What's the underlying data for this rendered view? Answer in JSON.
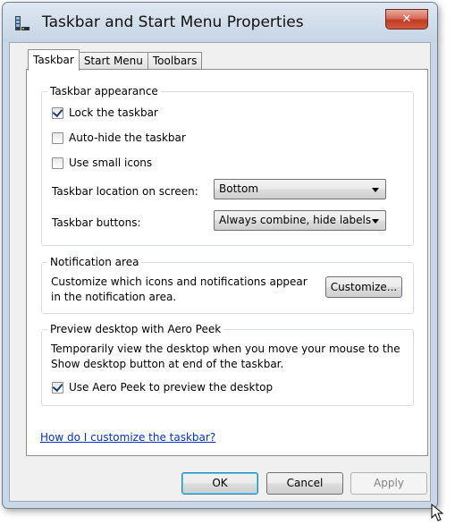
{
  "window": {
    "title": "Taskbar and Start Menu Properties",
    "close_label": "✕"
  },
  "tabs": [
    {
      "label": "Taskbar",
      "active": true
    },
    {
      "label": "Start Menu",
      "active": false
    },
    {
      "label": "Toolbars",
      "active": false
    }
  ],
  "taskbar_appearance": {
    "group_label": "Taskbar appearance",
    "lock_taskbar": {
      "label": "Lock the taskbar",
      "checked": true
    },
    "auto_hide": {
      "label": "Auto-hide the taskbar",
      "checked": false
    },
    "small_icons": {
      "label": "Use small icons",
      "checked": false
    },
    "location_label": "Taskbar location on screen:",
    "location_value": "Bottom",
    "buttons_label": "Taskbar buttons:",
    "buttons_value": "Always combine, hide labels"
  },
  "notification_area": {
    "group_label": "Notification area",
    "description": "Customize which icons and notifications appear in the notification area.",
    "customize_label": "Customize..."
  },
  "aero_peek": {
    "group_label": "Preview desktop with Aero Peek",
    "description": "Temporarily view the desktop when you move your mouse to the Show desktop button at end of the taskbar.",
    "use_aero_peek": {
      "label": "Use Aero Peek to preview the desktop",
      "checked": true
    }
  },
  "help_link": "How do I customize the taskbar?",
  "footer": {
    "ok_label": "OK",
    "cancel_label": "Cancel",
    "apply_label": "Apply"
  }
}
